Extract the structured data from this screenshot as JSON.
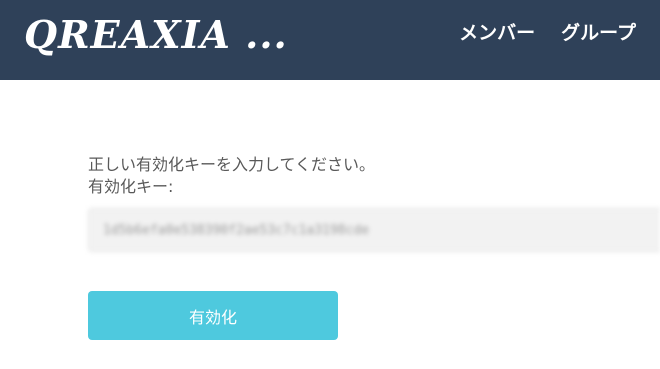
{
  "header": {
    "logo_text": "QREAXIA ...",
    "nav": {
      "members_label": "メンバー",
      "groups_label": "グループ"
    }
  },
  "form": {
    "instruction": "正しい有効化キーを入力してください。",
    "key_label": "有効化キー:",
    "key_value": "1d5b6efa0e538390f2ae53c7c1a3198cde",
    "submit_label": "有効化"
  },
  "colors": {
    "header_bg": "#2f4159",
    "button_bg": "#4ec9de",
    "input_bg": "#f2f2f2",
    "text": "#595959"
  }
}
